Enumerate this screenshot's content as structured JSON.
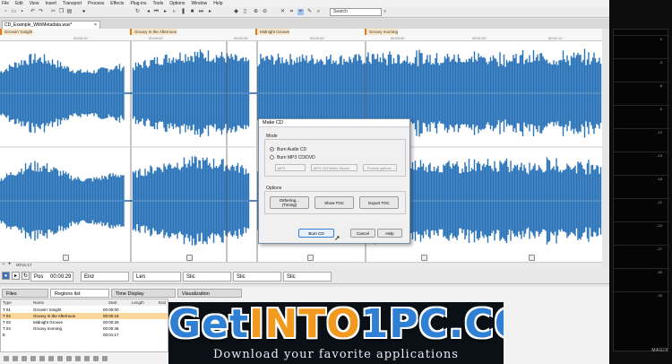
{
  "menu": [
    "File",
    "Edit",
    "View",
    "Insert",
    "Transport",
    "Process",
    "Effects",
    "Plug-ins",
    "Tools",
    "Options",
    "Window",
    "Help"
  ],
  "toolbar": {
    "search_placeholder": "Search"
  },
  "file_tab": {
    "label": "CD_Example_WithMetadata.wav*",
    "close": "×"
  },
  "markers": [
    "Groovin' tonight",
    "Groovy in the Afternoon",
    "Midnight Groove",
    "Groovy morning"
  ],
  "ruler_ticks": [
    "00:00:10",
    "00:00:20",
    "00:00:30",
    "00:00:40",
    "00:00:50",
    "00:01:00",
    "00:01:10"
  ],
  "position_readout": "00:01:17",
  "transport": {
    "pos_label": "Pos",
    "pos_value": "00:00:29",
    "end_label": "End",
    "len_label": "Len",
    "slice1": "Slic",
    "slice2": "Slic",
    "slice3": "Slic"
  },
  "bottom_tabs": {
    "files": "Files",
    "regions": "Regions list",
    "time_display": "Time Display",
    "visualization": "Visualization"
  },
  "region_list": {
    "headers": {
      "type": "Type",
      "name": "Name",
      "start": "Start",
      "length": "Length",
      "end": "End"
    },
    "rows": [
      {
        "type": "T 01",
        "name": "Groovin' tonight",
        "start": "00:00:00"
      },
      {
        "type": "T 02",
        "name": "Groovy in the Afternoon",
        "start": "00:00:16"
      },
      {
        "type": "T 03",
        "name": "Midnight Groove",
        "start": "00:00:29"
      },
      {
        "type": "T 04",
        "name": "Groovy morning",
        "start": "00:00:46"
      },
      {
        "type": "E",
        "name": "",
        "start": "00:01:17"
      }
    ]
  },
  "dialog": {
    "title": "Make CD",
    "mode_label": "Mode",
    "radio_audio": "Burn Audio CD",
    "radio_mp3": "Burn MP3 CD/DVD",
    "select_format": "MP3",
    "select_quality": "MP3 192 kBit/s Stereo",
    "format_options": "Format options...",
    "options_label": "Options",
    "btn_dithering": "Dithering...\n(Timing)",
    "btn_show_toc": "Show TOC",
    "btn_export_toc": "Export TOC",
    "btn_burn": "Burn CD",
    "btn_cancel": "Cancel",
    "btn_help": "Help"
  },
  "meter": {
    "scale": [
      "0",
      "-3",
      "-6",
      "-9",
      "-12",
      "-15",
      "-18",
      "-21",
      "-24",
      "-27",
      "-30",
      "-33"
    ],
    "brand": "MAGIX"
  },
  "banner": {
    "title_a": "Get",
    "title_b": "INTO",
    "title_c": "1PC",
    "title_d": ".COM",
    "subtitle": "Download your favorite applications"
  },
  "colors": {
    "waveform": "#2a73b8",
    "marker": "#e07a1e",
    "selection": "#fbd79b"
  }
}
